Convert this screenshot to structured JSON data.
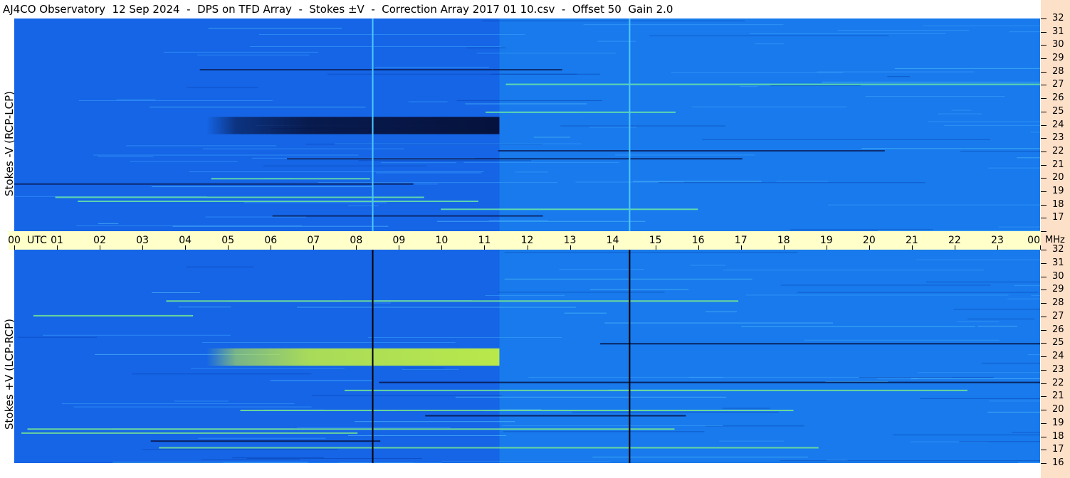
{
  "header": {
    "title": "AJ4CO Observatory  12 Sep 2024  -  DPS on TFD Array  -  Stokes ±V  -  Correction Array 2017 01 10.csv  -  Offset 50  Gain 2.0"
  },
  "chart_data": {
    "type": "heatmap",
    "title": "AJ4CO Observatory  12 Sep 2024  -  DPS on TFD Array  -  Stokes ±V  -  Correction Array 2017 01 10.csv  -  Offset 50  Gain 2.0",
    "x_axis": {
      "label": "UTC",
      "ticks": [
        "00",
        "01",
        "02",
        "03",
        "04",
        "05",
        "06",
        "07",
        "08",
        "09",
        "10",
        "11",
        "12",
        "13",
        "14",
        "15",
        "16",
        "17",
        "18",
        "19",
        "20",
        "21",
        "22",
        "23",
        "00"
      ],
      "range_hours": [
        0,
        24
      ]
    },
    "y_axis": {
      "unit": "MHz",
      "ticks": [
        "32",
        "31",
        "30",
        "29",
        "28",
        "27",
        "26",
        "25",
        "24",
        "23",
        "22",
        "21",
        "20",
        "19",
        "18",
        "17",
        "16"
      ],
      "range_mhz": [
        16,
        32
      ]
    },
    "panels": [
      {
        "label": "Stokes -V  (RCP-LCP)",
        "band_color": "#06123d",
        "band_mhz": [
          23.3,
          24.6
        ],
        "band_hours": [
          4.5,
          11.35
        ]
      },
      {
        "label": "Stokes +V  (LCP-RCP)",
        "band_color": "#b9e84a",
        "band_mhz": [
          23.3,
          24.6
        ],
        "band_hours": [
          4.5,
          11.35
        ]
      }
    ],
    "colors": {
      "background": "#1565e6",
      "day_background": "#1c8cf0",
      "axis_band": "#ffffc9",
      "frequency_column": "#fde0c8"
    },
    "vertical_lines_hours": [
      8.37,
      14.38
    ]
  }
}
